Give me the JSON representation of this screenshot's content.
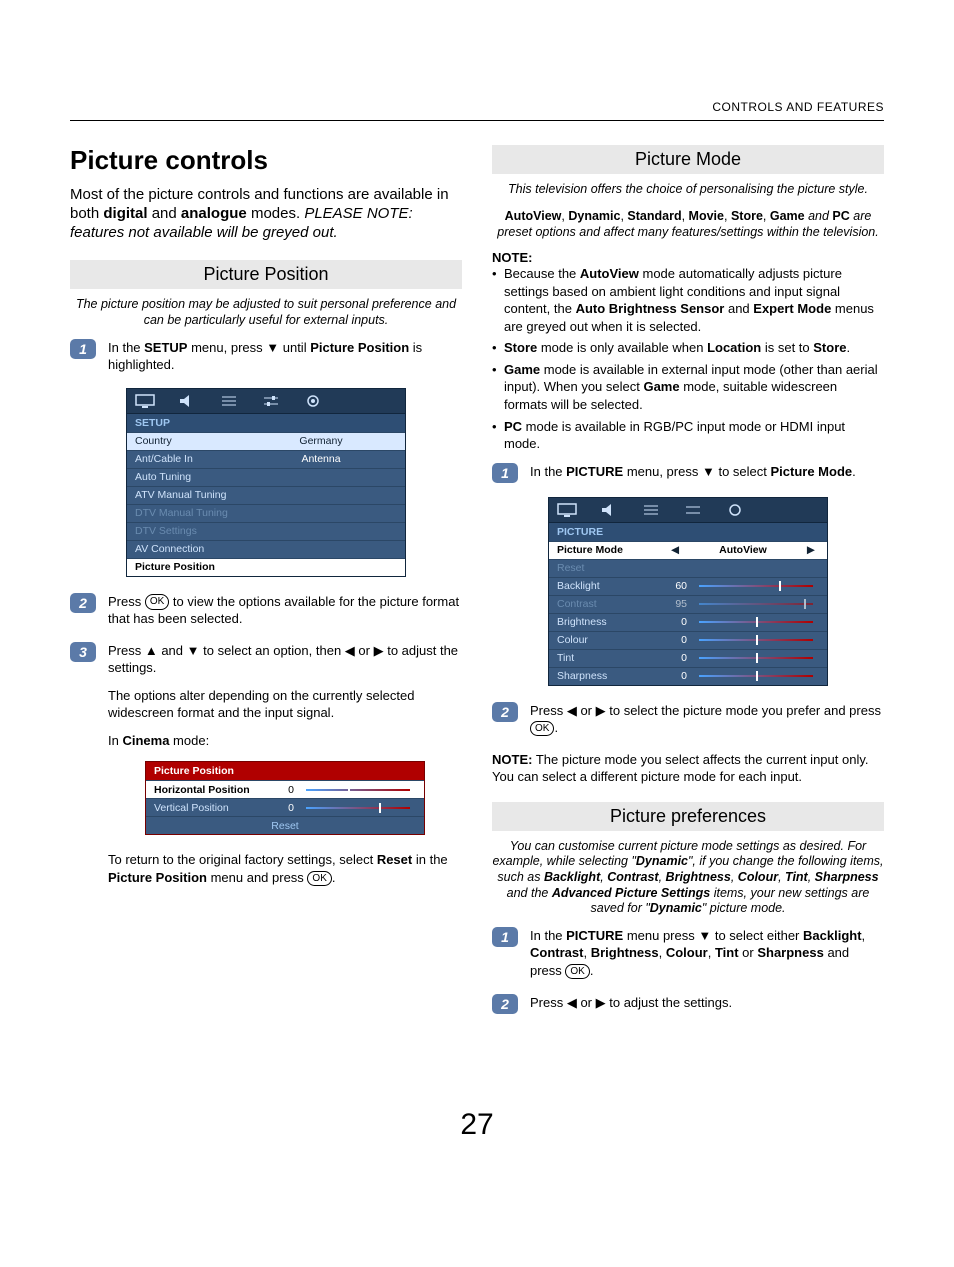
{
  "header": {
    "section": "CONTROLS AND FEATURES"
  },
  "page_number": "27",
  "left": {
    "h1": "Picture controls",
    "intro_plain1": "Most of the picture controls and functions are available in both ",
    "intro_b1": "digital",
    "intro_plain2": " and ",
    "intro_b2": "analogue",
    "intro_plain3": " modes. ",
    "intro_italic": "PLEASE NOTE: features not available will be greyed out.",
    "position": {
      "head": "Picture Position",
      "blurb": "The picture position may be adjusted to suit personal preference and can be particularly useful for external inputs.",
      "step1_a": "In the ",
      "step1_b": "SETUP",
      "step1_c": " menu, press ",
      "step1_d": " until ",
      "step1_e": "Picture Position",
      "step1_f": " is highlighted.",
      "step2": "Press ",
      "step2b": " to view the options available for the picture format that has been selected.",
      "step3a": "Press ",
      "step3b": " and ",
      "step3c": " to select an option, then ",
      "step3d": " or ",
      "step3e": " to adjust the settings.",
      "step3_p2": "The options alter depending on the currently selected widescreen format and the input signal.",
      "step3_p3a": "In ",
      "step3_p3b": "Cinema",
      "step3_p3c": " mode:",
      "return_a": "To return to the original factory settings, select ",
      "return_b": "Reset",
      "return_c": " in the ",
      "return_d": "Picture Position",
      "return_e": " menu and press "
    },
    "setup_menu": {
      "title": "SETUP",
      "rows": [
        {
          "label": "Country",
          "val": "Germany",
          "hl": true
        },
        {
          "label": "Ant/Cable In",
          "val": "Antenna"
        },
        {
          "label": "Auto Tuning"
        },
        {
          "label": "ATV Manual Tuning"
        },
        {
          "label": "DTV Manual Tuning",
          "grey": true
        },
        {
          "label": "DTV Settings",
          "grey": true
        },
        {
          "label": "AV Connection"
        },
        {
          "label": "Picture Position",
          "white": true
        }
      ]
    },
    "pp_menu": {
      "head": "Picture Position",
      "rows": [
        {
          "label": "Horizontal Position",
          "num": "0",
          "knob": 40
        },
        {
          "label": "Vertical Position",
          "num": "0",
          "knob": 70
        }
      ],
      "reset": "Reset"
    }
  },
  "right": {
    "mode": {
      "head": "Picture Mode",
      "blurb": "This television offers the choice of personalising the picture style.",
      "preset_a": "AutoView",
      "preset_b": "Dynamic",
      "preset_c": "Standard",
      "preset_d": "Movie",
      "preset_e": "Store",
      "preset_f": "Game",
      "preset_g": "PC",
      "preset_mid": " and ",
      "preset_tail": " are preset options and affect many features/settings within the television.",
      "note_label": "NOTE:",
      "b1a": "Because the ",
      "b1b": "AutoView",
      "b1c": " mode automatically adjusts picture settings based on ambient light conditions and input signal content, the ",
      "b1d": "Auto Brightness Sensor",
      "b1e": " and ",
      "b1f": "Expert Mode",
      "b1g": " menus are greyed out when it is selected.",
      "b2a": "Store",
      "b2b": " mode is only available when ",
      "b2c": "Location",
      "b2d": " is set to ",
      "b2e": "Store",
      "b2f": ".",
      "b3a": "Game",
      "b3b": " mode is available in external input mode (other than aerial input). When you select ",
      "b3c": "Game",
      "b3d": " mode, suitable widescreen formats will be selected.",
      "b4a": "PC",
      "b4b": " mode is available in RGB/PC input mode or HDMI input mode.",
      "step1a": "In the ",
      "step1b": "PICTURE",
      "step1c": " menu, press ",
      "step1d": " to select ",
      "step1e": "Picture Mode",
      "step1f": ".",
      "step2a": "Press ",
      "step2b": " or ",
      "step2c": " to select the picture mode you prefer and press ",
      "note2a": "NOTE:",
      "note2b": " The picture mode you select affects the current input only. You can select a different picture mode for each input."
    },
    "picture_menu": {
      "title": "PICTURE",
      "rows": [
        {
          "label": "Picture Mode",
          "val": "AutoView",
          "hl": true,
          "arrows": true
        },
        {
          "label": "Reset",
          "grey": true
        },
        {
          "label": "Backlight",
          "num": "60",
          "knob": 70
        },
        {
          "label": "Contrast",
          "num": "95",
          "knob": 92,
          "grey": true
        },
        {
          "label": "Brightness",
          "num": "0",
          "knob": 50
        },
        {
          "label": "Colour",
          "num": "0",
          "knob": 50
        },
        {
          "label": "Tint",
          "num": "0",
          "knob": 50
        },
        {
          "label": "Sharpness",
          "num": "0",
          "knob": 50
        }
      ]
    },
    "prefs": {
      "head": "Picture preferences",
      "blurb_a": "You can customise current picture mode settings as desired. For example, while selecting \"",
      "blurb_b": "Dynamic",
      "blurb_c": "\", if you change the following items, such as ",
      "blurb_d": "Backlight",
      "blurb_e": "Contrast",
      "blurb_f": "Brightness",
      "blurb_g": "Colour",
      "blurb_h": "Tint",
      "blurb_i": "Sharpness",
      "blurb_j": " and the ",
      "blurb_k": "Advanced Picture Settings",
      "blurb_l": " items, your new settings are saved for \"",
      "blurb_m": "Dynamic",
      "blurb_n": "\" picture mode.",
      "s1a": "In the ",
      "s1b": "PICTURE",
      "s1c": " menu press ",
      "s1d": " to select either ",
      "s1e": "Backlight",
      "s1f": "Contrast",
      "s1g": "Brightness",
      "s1h": "Colour",
      "s1i": "Tint",
      "s1j": "Sharpness",
      "s1k": " and press ",
      "s2a": "Press ",
      "s2b": " or ",
      "s2c": " to adjust the settings."
    }
  }
}
